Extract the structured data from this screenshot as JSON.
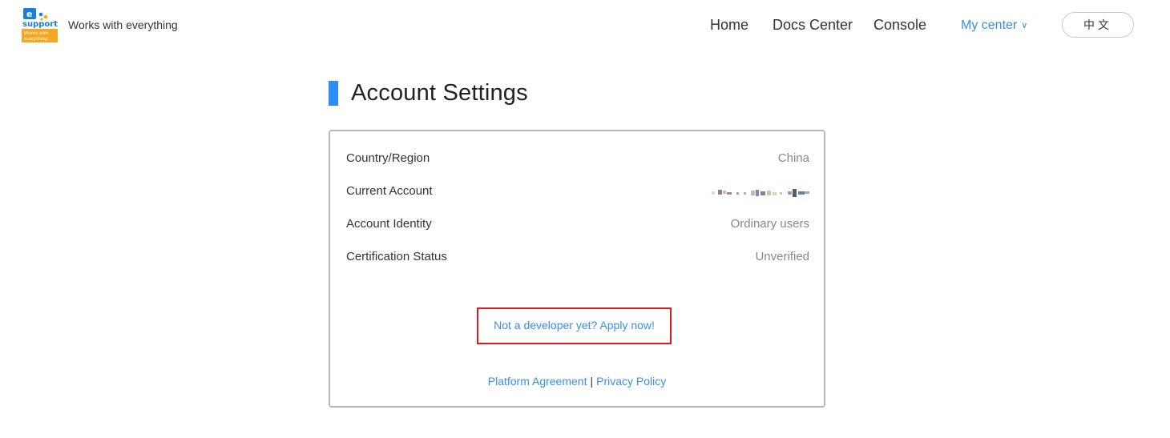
{
  "header": {
    "logo_text": "e support",
    "logo_sub": "Works with everything",
    "tagline": "Works with everything",
    "nav": {
      "home": "Home",
      "docs": "Docs Center",
      "console": "Console",
      "my_center": "My center",
      "chevron": "∨"
    },
    "lang_button": "中文"
  },
  "page": {
    "title": "Account Settings"
  },
  "account": {
    "rows": [
      {
        "label": "Country/Region",
        "value": "China"
      },
      {
        "label": "Current Account",
        "value": ""
      },
      {
        "label": "Account Identity",
        "value": "Ordinary users"
      },
      {
        "label": "Certification Status",
        "value": "Unverified"
      }
    ],
    "apply_link": "Not a developer yet? Apply now!",
    "footer": {
      "agreement": "Platform Agreement",
      "separator": "|",
      "privacy": "Privacy Policy"
    }
  },
  "colors": {
    "accent": "#3a8ee6",
    "title_bar": "#2c8ef8",
    "highlight_border": "#e01c1c",
    "logo_blue": "#1a7fd6",
    "logo_orange": "#f5a623"
  }
}
